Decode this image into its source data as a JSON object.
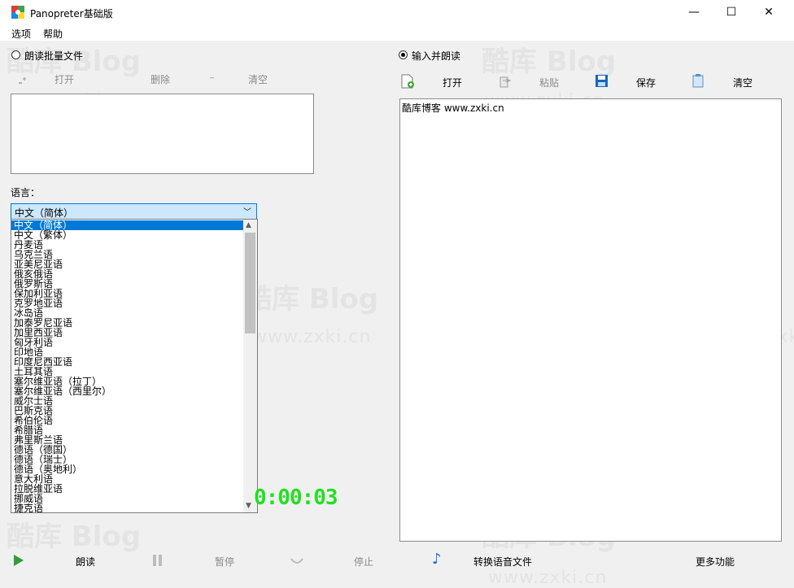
{
  "window": {
    "title": "Panopreter基础版",
    "minimize": "—",
    "maximize": "☐",
    "close": "✕"
  },
  "menu": [
    "选项",
    "帮助"
  ],
  "left": {
    "radio_label": "朗读批量文件",
    "open": "打开",
    "delete": "删除",
    "clear": "清空",
    "language_label": "语言：",
    "language_selected": "中文（简体）",
    "languages": [
      "中文（简体）",
      "中文（繁体）",
      "丹麦语",
      "乌克兰语",
      "亚美尼亚语",
      "俄亥俄语",
      "俄罗斯语",
      "保加利亚语",
      "克罗地亚语",
      "冰岛语",
      "加泰罗尼亚语",
      "加里西亚语",
      "匈牙利语",
      "印地语",
      "印度尼西亚语",
      "土耳其语",
      "塞尔维亚语（拉丁）",
      "塞尔维亚语（西里尔）",
      "威尔士语",
      "巴斯克语",
      "希伯伦语",
      "希腊语",
      "弗里斯兰语",
      "德语（德国）",
      "德语（瑞士）",
      "德语（奥地利）",
      "意大利语",
      "拉脱维亚语",
      "挪威语",
      "捷克语"
    ],
    "timer": "0:00:03"
  },
  "right": {
    "radio_label": "输入并朗读",
    "open": "打开",
    "paste": "粘贴",
    "save": "保存",
    "clear": "清空",
    "text": "酷库博客 www.zxki.cn"
  },
  "bottom": {
    "read": "朗读",
    "pause": "暂停",
    "stop": "停止",
    "convert": "转换语音文件",
    "more": "更多功能"
  },
  "watermark": {
    "cn": "酷库",
    "blog": "Blog",
    "url": "www.zxki.cn"
  },
  "colors": {
    "accent": "#0078d7",
    "timer": "#22e022",
    "selection": "#cce8ff"
  }
}
